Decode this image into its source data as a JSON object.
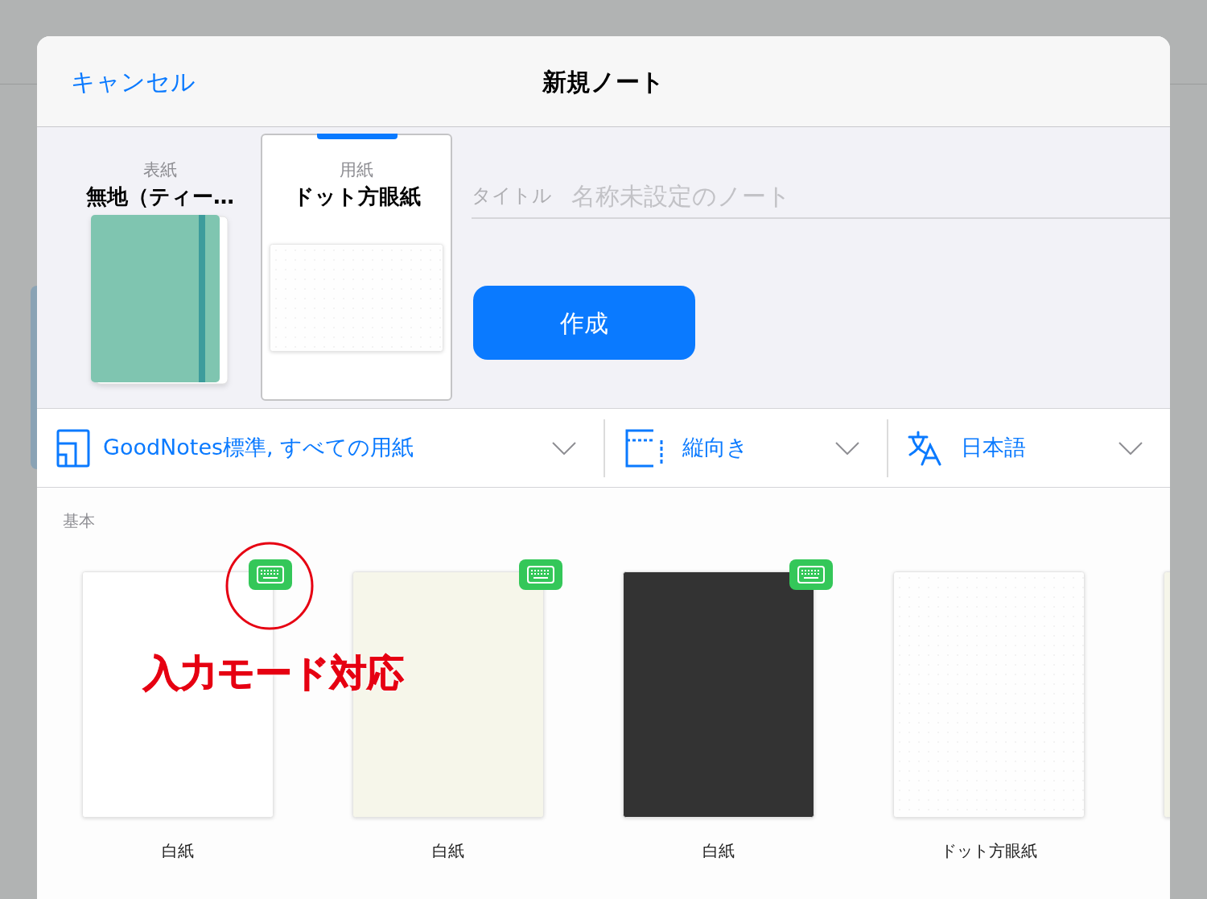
{
  "header": {
    "cancel": "キャンセル",
    "title": "新規ノート"
  },
  "selectors": [
    {
      "kind": "cover",
      "label": "表紙",
      "value": "無地（ティー…",
      "selected": false
    },
    {
      "kind": "paper",
      "label": "用紙",
      "value": "ドット方眼紙",
      "selected": true
    }
  ],
  "title_field": {
    "label": "タイトル",
    "placeholder": "名称未設定のノート"
  },
  "create_button": "作成",
  "toolbar": [
    {
      "kind": "template",
      "text": "GoodNotes標準, すべての用紙"
    },
    {
      "kind": "orientation",
      "text": "縦向き"
    },
    {
      "kind": "language",
      "text": "日本語"
    }
  ],
  "section": "基本",
  "templates": [
    {
      "kind": "plain",
      "color": "#ffffff",
      "label": "白紙",
      "keyboard": true
    },
    {
      "kind": "plain",
      "color": "#f6f6ea",
      "label": "白紙",
      "keyboard": true
    },
    {
      "kind": "plain",
      "color": "#333333",
      "label": "白紙",
      "keyboard": true
    },
    {
      "kind": "dotted",
      "color": "#fefefe",
      "label": "ドット方眼紙",
      "keyboard": false
    },
    {
      "kind": "plain",
      "color": "#f6f6ea",
      "keyboard": false
    }
  ],
  "annotation": "入力モード対応"
}
